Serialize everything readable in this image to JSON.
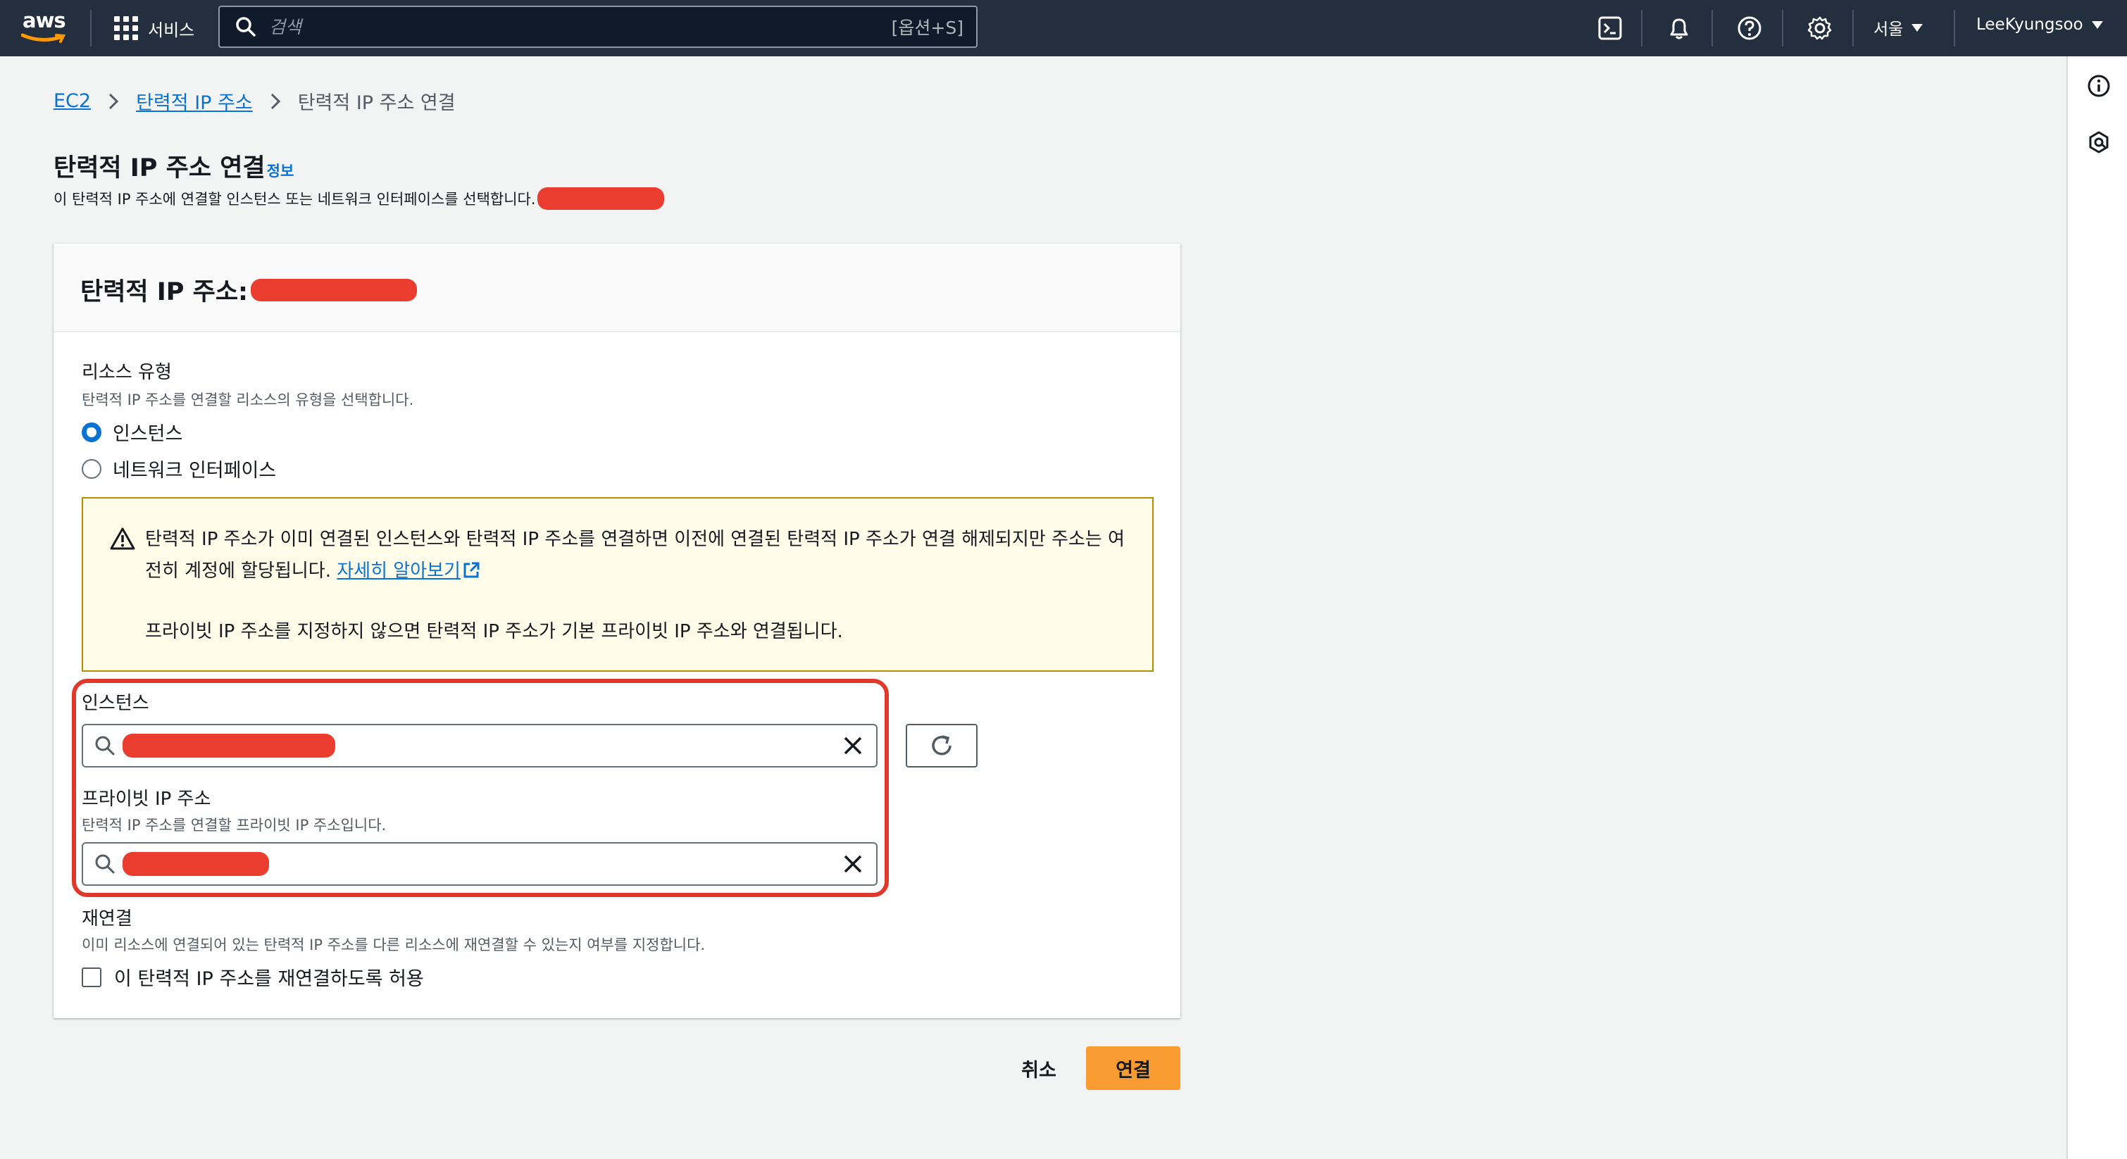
{
  "topnav": {
    "logo_text": "aws",
    "services_label": "서비스",
    "search_placeholder": "검색",
    "search_shortcut": "[옵션+S]",
    "region_label": "서울",
    "account_label": "LeeKyungsoo",
    "icons": [
      "cloudshell-icon",
      "bell-icon",
      "help-icon",
      "settings-icon"
    ]
  },
  "breadcrumb": {
    "items": [
      "EC2",
      "탄력적 IP 주소"
    ],
    "current": "탄력적 IP 주소 연결"
  },
  "page": {
    "title": "탄력적 IP 주소 연결",
    "info_link": "정보",
    "description": "이 탄력적 IP 주소에 연결할 인스턴스 또는 네트워크 인터페이스를 선택합니다."
  },
  "card": {
    "title": "탄력적 IP 주소:",
    "resource_type": {
      "label": "리소스 유형",
      "description": "탄력적 IP 주소를 연결할 리소스의 유형을 선택합니다.",
      "options": [
        "인스턴스",
        "네트워크 인터페이스"
      ],
      "selected": "인스턴스"
    },
    "alert": {
      "text": "탄력적 IP 주소가 이미 연결된 인스턴스와 탄력적 IP 주소를 연결하면 이전에 연결된 탄력적 IP 주소가 연결 해제되지만 주소는 여전히 계정에 할당됩니다. ",
      "link": "자세히 알아보기",
      "text2": "프라이빗 IP 주소를 지정하지 않으면 탄력적 IP 주소가 기본 프라이빗 IP 주소와 연결됩니다."
    },
    "instance": {
      "label": "인스턴스"
    },
    "private_ip": {
      "label": "프라이빗 IP 주소",
      "description": "탄력적 IP 주소를 연결할 프라이빗 IP 주소입니다."
    },
    "reassociation": {
      "label": "재연결",
      "description": "이미 리소스에 연결되어 있는 탄력적 IP 주소를 다른 리소스에 재연결할 수 있는지 여부를 지정합니다.",
      "checkbox_label": "이 탄력적 IP 주소를 재연결하도록 허용",
      "checked": false
    }
  },
  "actions": {
    "cancel": "취소",
    "submit": "연결"
  },
  "colors": {
    "nav_bg": "#232f3e",
    "link": "#0972d3",
    "primary_button": "#f89b31",
    "redaction": "#ea3d2f",
    "alert_bg": "#fffce9"
  }
}
